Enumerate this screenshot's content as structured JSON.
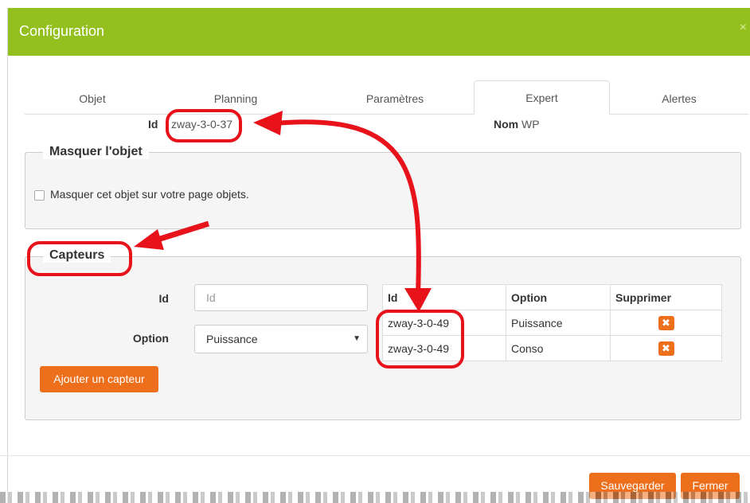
{
  "modal": {
    "title": "Configuration",
    "close_symbol": "×"
  },
  "tabs": [
    "Objet",
    "Planning",
    "Paramètres",
    "Expert",
    "Alertes"
  ],
  "active_tab": "Expert",
  "info": {
    "id_label": "Id",
    "id_value": "zway-3-0-37",
    "name_label": "Nom",
    "name_value": "WP"
  },
  "hide_section": {
    "legend": "Masquer l'objet",
    "checkbox_label": "Masquer cet objet sur votre page objets.",
    "checked": false
  },
  "sensors": {
    "legend": "Capteurs",
    "id_label": "Id",
    "id_placeholder": "Id",
    "option_label": "Option",
    "option_selected": "Puissance",
    "add_button": "Ajouter un capteur",
    "table": {
      "headers": [
        "Id",
        "Option",
        "Supprimer"
      ],
      "rows": [
        {
          "id": "zway-3-0-49",
          "option": "Puissance"
        },
        {
          "id": "zway-3-0-49",
          "option": "Conso"
        }
      ],
      "delete_symbol": "✖"
    }
  },
  "footer": {
    "save": "Sauvegarder",
    "close": "Fermer"
  },
  "colors": {
    "header": "#93c01f",
    "accent": "#ed6f1b",
    "annotation": "#e8121b"
  }
}
